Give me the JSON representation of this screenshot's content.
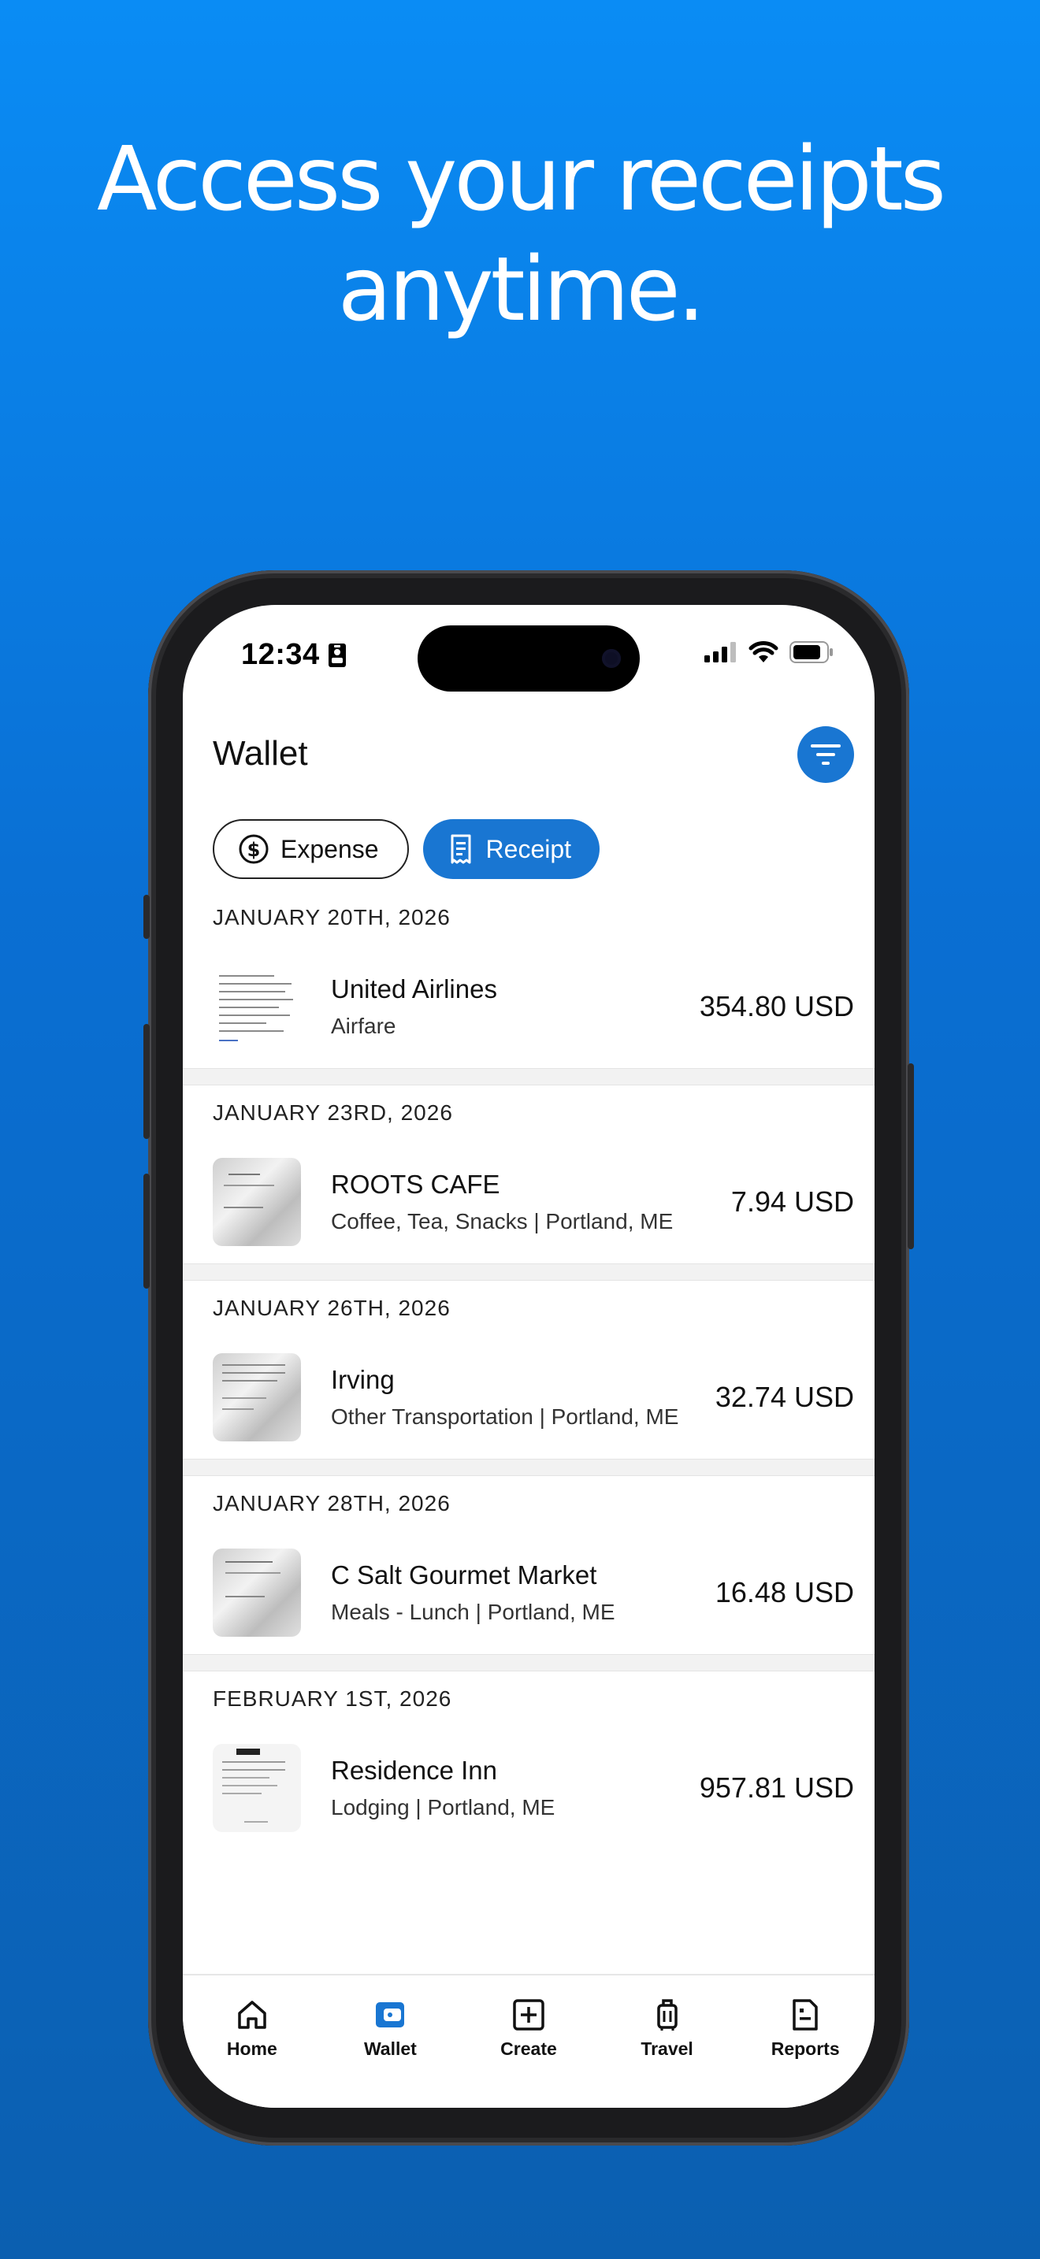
{
  "headline": {
    "line1": "Access your receipts",
    "line2": "anytime."
  },
  "status": {
    "time": "12:34"
  },
  "header": {
    "title": "Wallet"
  },
  "chips": [
    {
      "label": "Expense",
      "icon": "dollar-circle-icon",
      "selected": false
    },
    {
      "label": "Receipt",
      "icon": "receipt-icon",
      "selected": true
    }
  ],
  "entries": [
    {
      "date": "JANUARY 20TH, 2026",
      "merchant": "United Airlines",
      "category": "Airfare",
      "amount": "354.80 USD"
    },
    {
      "date": "JANUARY 23RD, 2026",
      "merchant": "ROOTS CAFE",
      "category": "Coffee, Tea, Snacks | Portland, ME",
      "amount": "7.94 USD"
    },
    {
      "date": "JANUARY 26TH, 2026",
      "merchant": "Irving",
      "category": "Other Transportation | Portland, ME",
      "amount": "32.74 USD"
    },
    {
      "date": "JANUARY 28TH, 2026",
      "merchant": "C Salt Gourmet Market",
      "category": "Meals - Lunch | Portland, ME",
      "amount": "16.48 USD"
    },
    {
      "date": "FEBRUARY 1ST, 2026",
      "merchant": "Residence Inn",
      "category": "Lodging | Portland, ME",
      "amount": "957.81 USD"
    }
  ],
  "tabs": [
    {
      "label": "Home",
      "icon": "home-icon"
    },
    {
      "label": "Wallet",
      "icon": "wallet-icon",
      "active": true
    },
    {
      "label": "Create",
      "icon": "plus-square-icon"
    },
    {
      "label": "Travel",
      "icon": "luggage-icon"
    },
    {
      "label": "Reports",
      "icon": "report-icon"
    }
  ],
  "colors": {
    "accent": "#1976d2",
    "background_top": "#0a8cf5",
    "background_bottom": "#0b5fb0"
  }
}
